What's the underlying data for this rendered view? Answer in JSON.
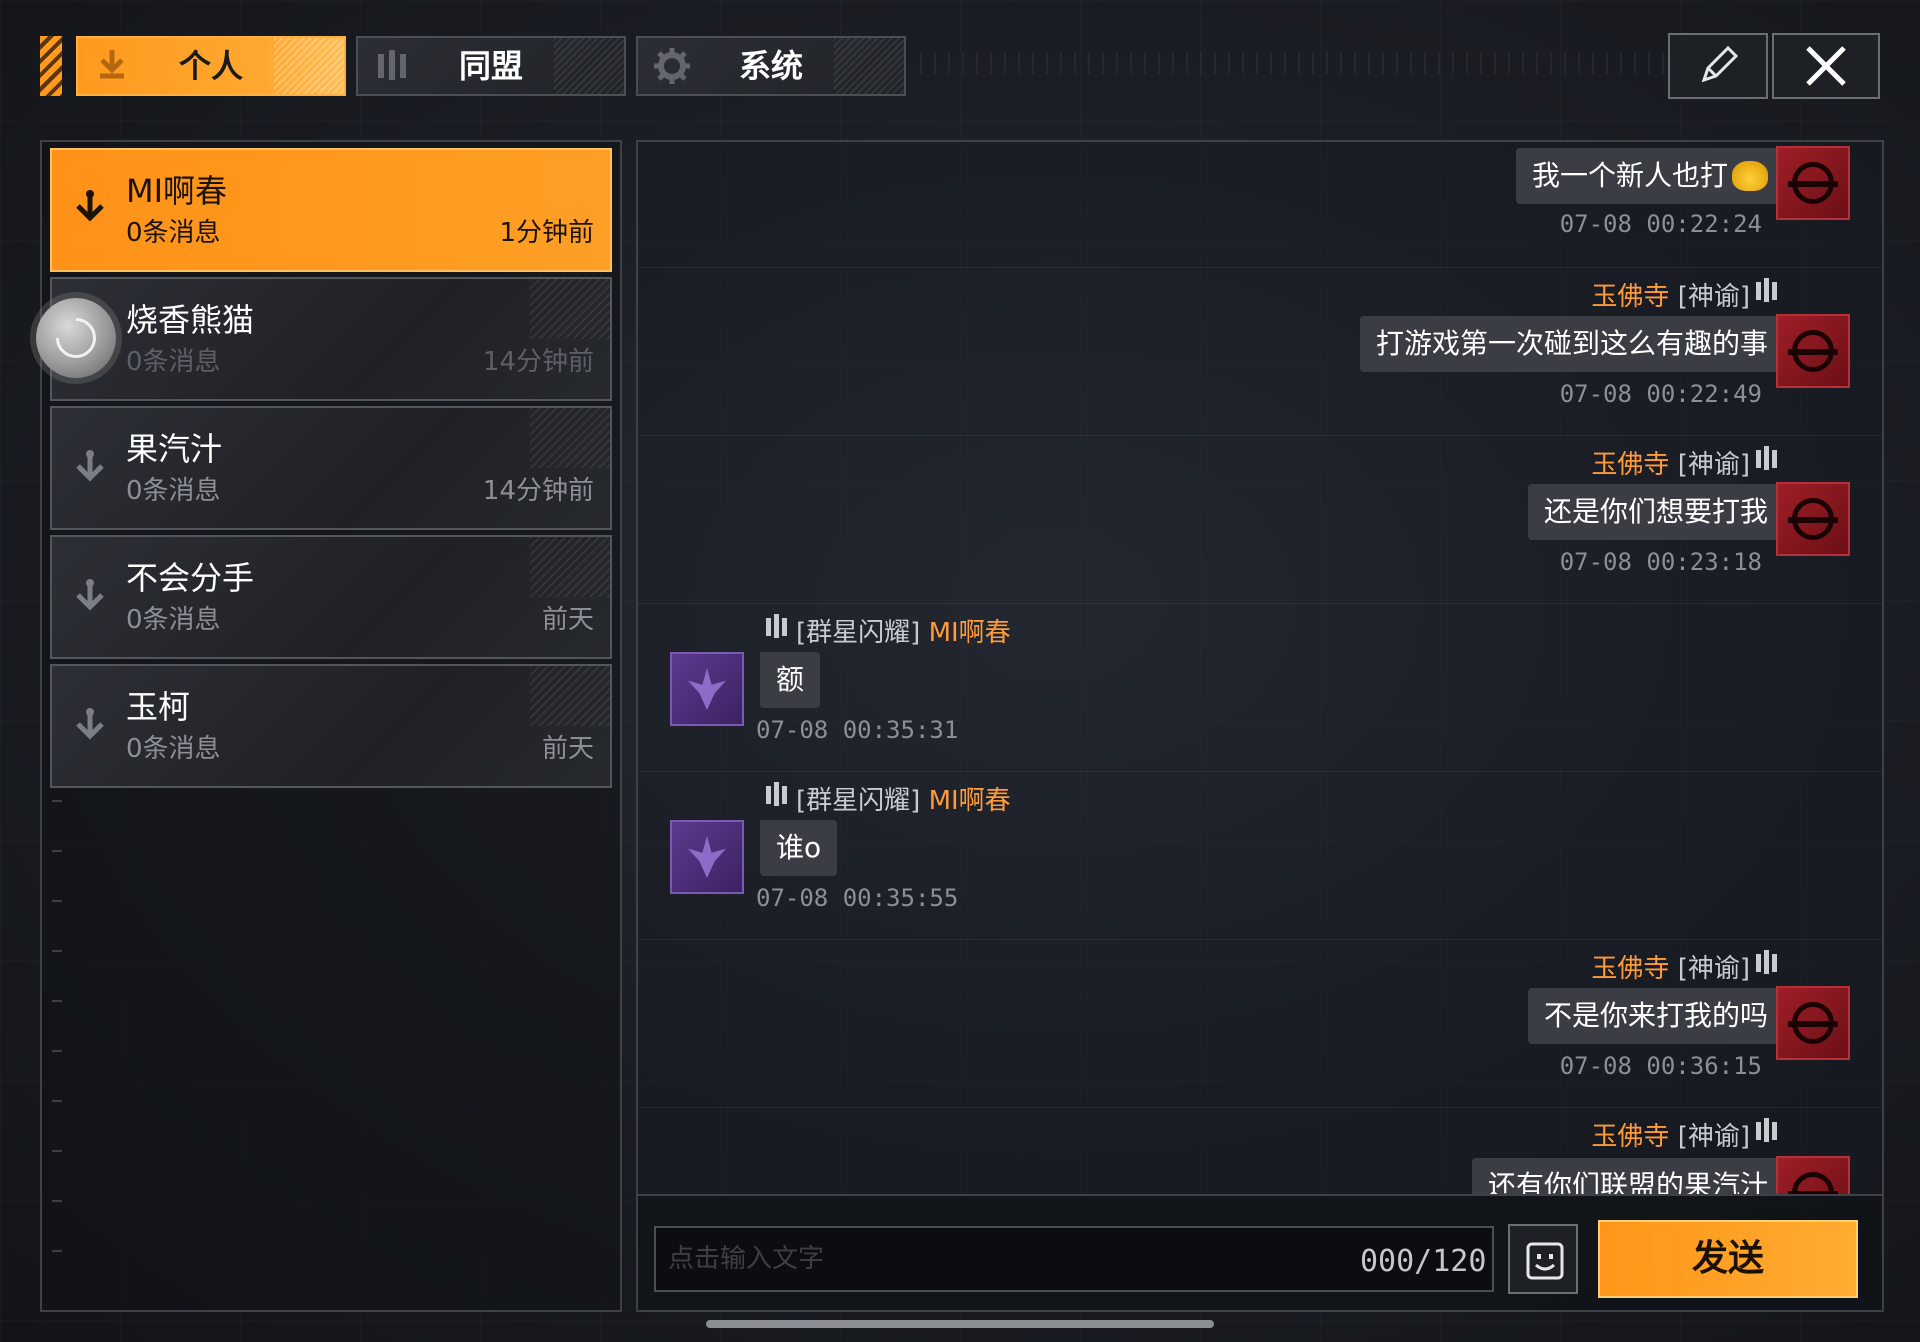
{
  "tabs": [
    {
      "label": "个人",
      "active": true,
      "icon": "person-down-icon"
    },
    {
      "label": "同盟",
      "active": false,
      "icon": "alliance-icon"
    },
    {
      "label": "系统",
      "active": false,
      "icon": "gear-icon"
    }
  ],
  "toolbar": {
    "edit_icon": "pencil-icon",
    "close_icon": "close-icon"
  },
  "contacts": [
    {
      "name": "MI啊春",
      "count": "0条消息",
      "time": "1分钟前",
      "active": true
    },
    {
      "name": "烧香熊猫",
      "count": "0条消息",
      "time": "14分钟前",
      "active": false
    },
    {
      "name": "果汽汁",
      "count": "0条消息",
      "time": "14分钟前",
      "active": false
    },
    {
      "name": "不会分手",
      "count": "0条消息",
      "time": "前天",
      "active": false
    },
    {
      "name": "玉柯",
      "count": "0条消息",
      "time": "前天",
      "active": false
    }
  ],
  "messages": [
    {
      "side": "mine",
      "sender_name": "",
      "sender_guild": "",
      "text": "我一个新人也打",
      "time": "07-08 00:22:24",
      "emoji": true
    },
    {
      "side": "mine",
      "sender_name": "玉佛寺",
      "sender_guild": "[神谕]",
      "text": "打游戏第一次碰到这么有趣的事",
      "time": "07-08 00:22:49"
    },
    {
      "side": "mine",
      "sender_name": "玉佛寺",
      "sender_guild": "[神谕]",
      "text": "还是你们想要打我",
      "time": "07-08 00:23:18"
    },
    {
      "side": "theirs",
      "sender_name": "MI啊春",
      "sender_guild": "[群星闪耀]",
      "text": "额",
      "time": "07-08 00:35:31"
    },
    {
      "side": "theirs",
      "sender_name": "MI啊春",
      "sender_guild": "[群星闪耀]",
      "text": "谁o",
      "time": "07-08 00:35:55"
    },
    {
      "side": "mine",
      "sender_name": "玉佛寺",
      "sender_guild": "[神谕]",
      "text": "不是你来打我的吗",
      "time": "07-08 00:36:15"
    },
    {
      "side": "mine",
      "sender_name": "玉佛寺",
      "sender_guild": "[神谕]",
      "text": "还有你们联盟的果汽汁",
      "time": ""
    }
  ],
  "input": {
    "placeholder": "点击输入文字",
    "value": "",
    "counter": "000/120",
    "emoji_icon": "smiley-icon",
    "send_label": "发送"
  },
  "colors": {
    "accent": "#ff9a1e",
    "sender_name": "#ff9a3a",
    "bubble": "#3a3d44",
    "self_avatar": "#9e1e27",
    "other_avatar": "#5b3a8e"
  }
}
